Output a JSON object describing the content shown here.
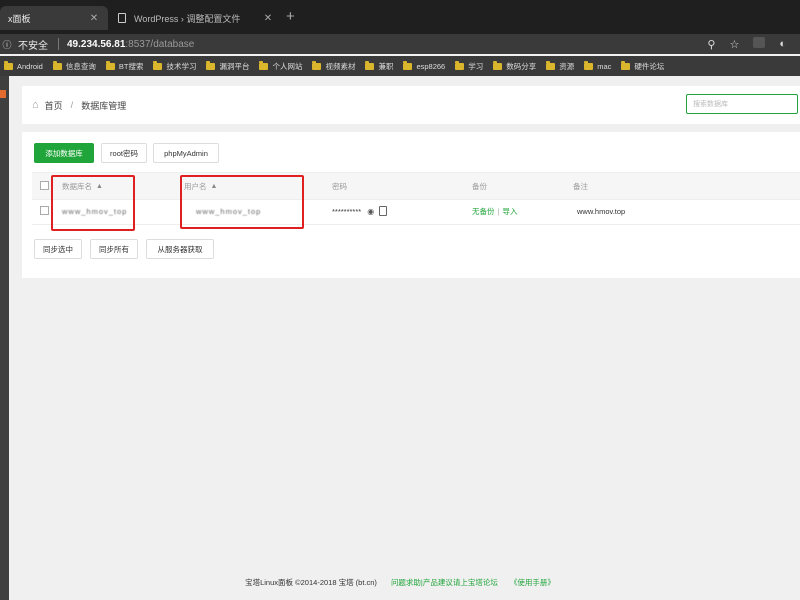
{
  "browser": {
    "tabs": [
      {
        "title": "x面板",
        "close": "✕"
      },
      {
        "title": "WordPress › 调整配置文件",
        "close": "✕"
      }
    ],
    "new_tab": "+",
    "address": {
      "security": "不安全",
      "host": "49.234.56.81",
      "rest": ":8537/database"
    },
    "bookmarks": [
      "Android",
      "信息查询",
      "BT搜索",
      "技术学习",
      "漏洞平台",
      "个人网站",
      "视频素材",
      "兼职",
      "esp8266",
      "学习",
      "数码分享",
      "资源",
      "mac",
      "硬件论坛"
    ]
  },
  "breadcrumb": {
    "home": "首页",
    "sep": "/",
    "current": "数据库管理"
  },
  "search": {
    "placeholder": "搜索数据库"
  },
  "toolbar": {
    "add_db": "添加数据库",
    "root_pwd": "root密码",
    "phpmyadmin": "phpMyAdmin"
  },
  "table": {
    "headers": {
      "db_name": "数据库名",
      "username": "用户名",
      "password": "密码",
      "backup": "备份",
      "note": "备注"
    },
    "sort_arrow": "▲",
    "rows": [
      {
        "db_name": "www_hmov_top",
        "username": "www_hmov_top",
        "password": "**********",
        "backup": "无备份",
        "import": "导入",
        "note": "www.hmov.top"
      }
    ],
    "pipe": "|"
  },
  "bottom_buttons": {
    "sync_selected": "同步选中",
    "sync_all": "同步所有",
    "from_server": "从服务器获取"
  },
  "footer": {
    "copyright": "宝塔Linux面板 ©2014-2018 宝塔 (bt.cn)",
    "forum": "问题求助|产品建议请上宝塔论坛",
    "manual": "《使用手册》"
  },
  "colors": {
    "accent": "#20a53a",
    "annotation": "#e02020",
    "tab_bg": "#1f1f1f",
    "toolbar_bg": "#3a3a3a"
  },
  "icons": {
    "info": "info-icon",
    "search": "search-icon",
    "star": "star-icon",
    "home": "home-icon",
    "eye": "eye-icon",
    "copy": "copy-icon",
    "folder": "folder-icon"
  }
}
